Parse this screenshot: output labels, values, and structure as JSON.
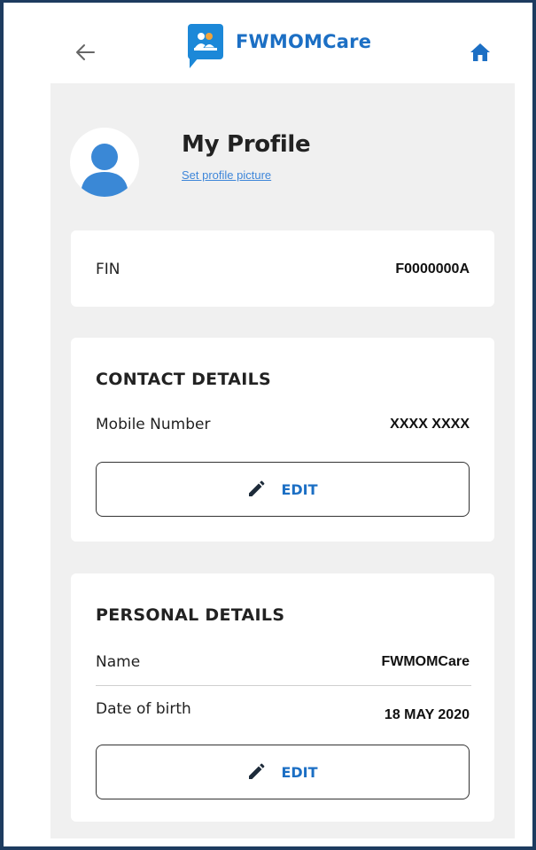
{
  "header": {
    "back_icon": "arrow-left-icon",
    "app_name": "FWMOMCare",
    "logo_icon": "people-chat-logo-icon",
    "home_icon": "home-icon",
    "accent_color": "#1c6fc4"
  },
  "profile": {
    "title": "My Profile",
    "set_picture_link": "Set profile picture",
    "avatar_icon": "user-avatar-icon",
    "avatar_color": "#3a88d6"
  },
  "fin": {
    "label": "FIN",
    "value": "F0000000A"
  },
  "contact_details": {
    "title": "CONTACT DETAILS",
    "mobile_label": "Mobile Number",
    "mobile_value": "XXXX XXXX",
    "edit_label": "EDIT",
    "edit_icon": "pencil-icon"
  },
  "personal_details": {
    "title": "PERSONAL DETAILS",
    "name_label": "Name",
    "name_value": "FWMOMCare",
    "dob_label": "Date of birth",
    "dob_value": "18 MAY 2020",
    "edit_label": "EDIT",
    "edit_icon": "pencil-icon"
  }
}
